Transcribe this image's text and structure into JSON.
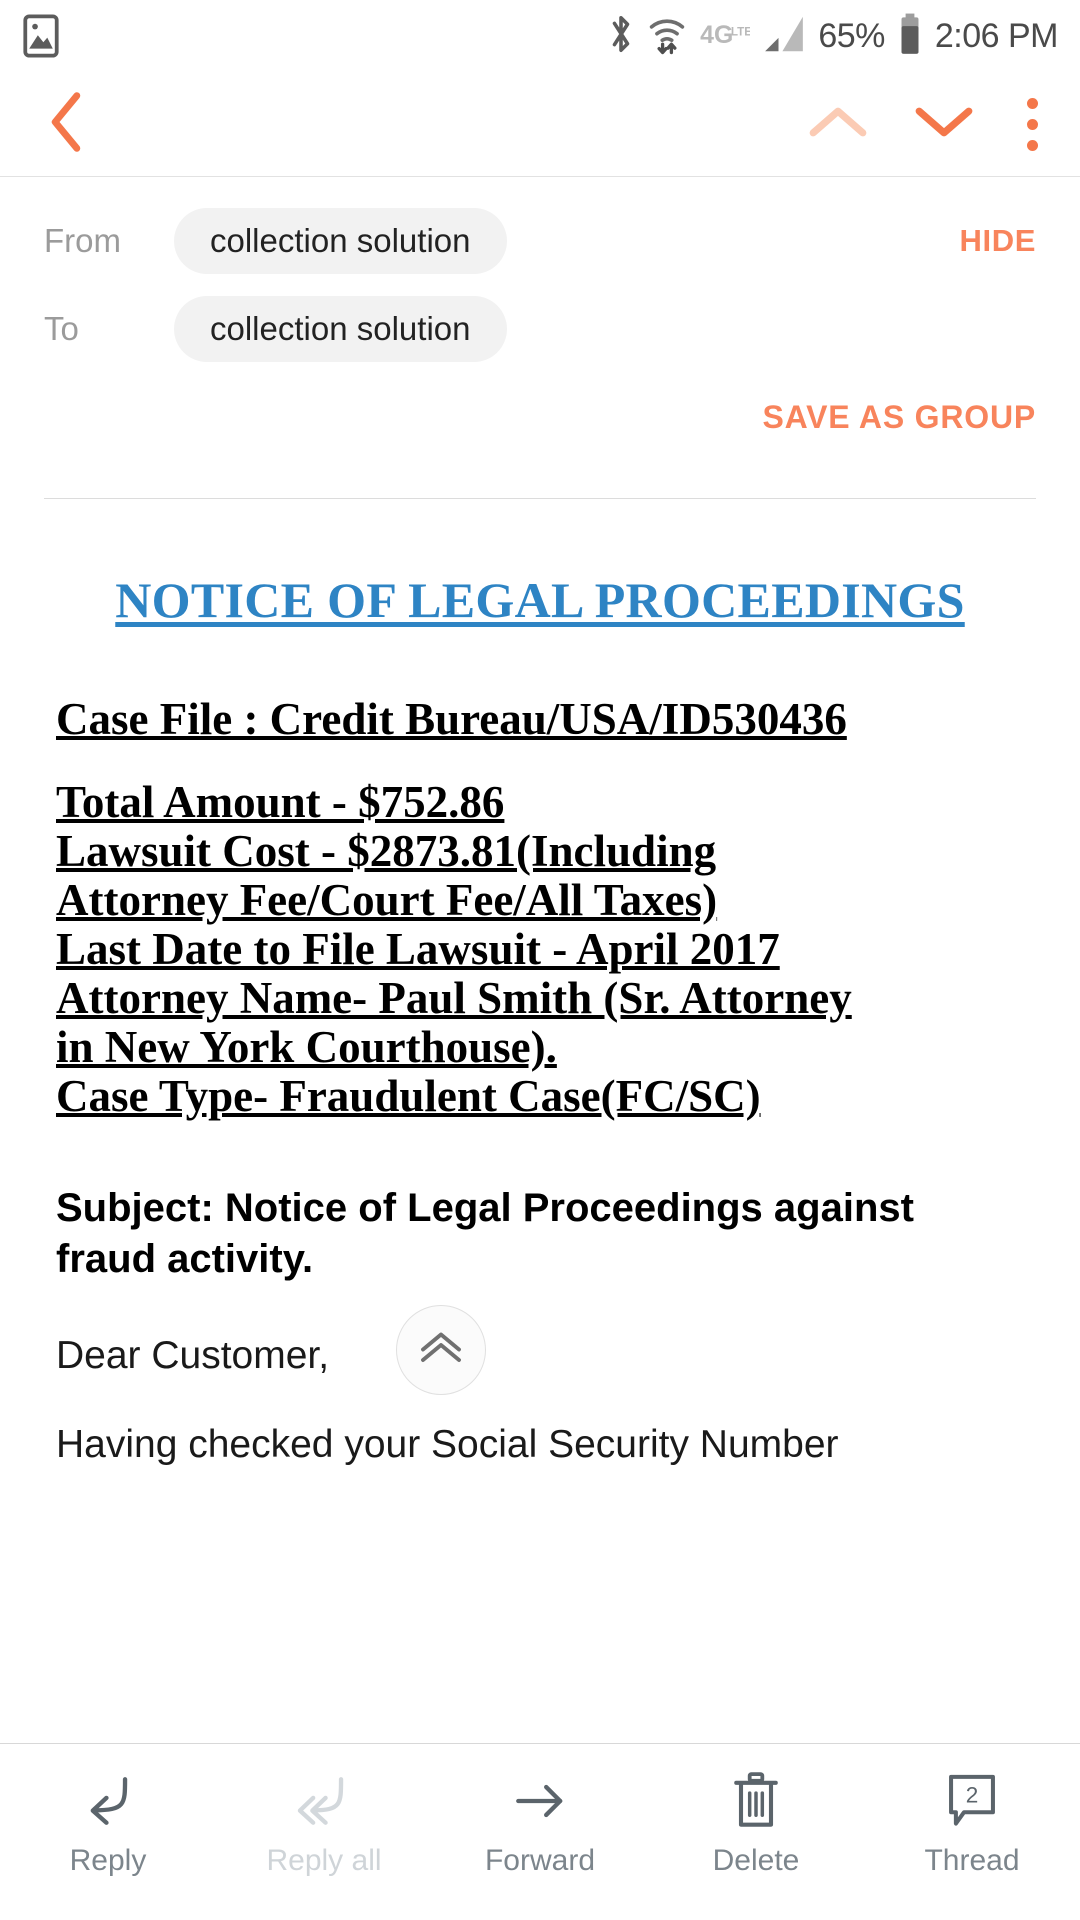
{
  "statusbar": {
    "left_icon": "image-icon",
    "icons": [
      "bluetooth-icon",
      "wifi-icon",
      "4glte-icon",
      "cellular-signal-icon"
    ],
    "battery_percent": "65%",
    "battery_icon": "battery-icon",
    "time": "2:06 PM"
  },
  "navbar": {
    "back_icon": "back-chevron-icon",
    "prev_icon": "chevron-up-icon",
    "next_icon": "chevron-down-icon",
    "overflow_icon": "more-vertical-icon",
    "accent_color": "#F4774A",
    "disabled_accent_color": "#FBCBB4"
  },
  "recipients": {
    "from_label": "From",
    "from_value": "collection solution",
    "to_label": "To",
    "to_value": "collection solution",
    "hide_label": "HIDE",
    "save_as_group_label": "SAVE AS GROUP",
    "link_color": "#F8845C"
  },
  "message": {
    "title": "NOTICE OF LEGAL PROCEEDINGS",
    "title_color": "#2E84C4",
    "details": [
      "Case File : Credit Bureau/USA/ID530436",
      "",
      "Total Amount  - $752.86",
      "Lawsuit Cost - $2873.81(Including",
      "Attorney Fee/Court Fee/All Taxes)",
      "Last Date to File Lawsuit - April 2017",
      "Attorney Name- Paul Smith (Sr. Attorney",
      "in New York Courthouse).",
      "Case Type- Fraudulent Case(FC/SC)"
    ],
    "subject": "Subject: Notice of Legal Proceedings against fraud activity.",
    "salutation": "Dear Customer,",
    "clipped_paragraph": "Having checked your Social Security Number"
  },
  "scroll_top_button": {
    "icon": "double-chevron-up-icon"
  },
  "bottombar": {
    "items": [
      {
        "label": "Reply",
        "icon": "reply-arrow-icon",
        "disabled": false,
        "badge": ""
      },
      {
        "label": "Reply all",
        "icon": "reply-all-arrow-icon",
        "disabled": true,
        "badge": ""
      },
      {
        "label": "Forward",
        "icon": "forward-arrow-icon",
        "disabled": false,
        "badge": ""
      },
      {
        "label": "Delete",
        "icon": "trash-icon",
        "disabled": false,
        "badge": ""
      },
      {
        "label": "Thread",
        "icon": "thread-bubble-icon",
        "disabled": false,
        "badge": "2"
      }
    ]
  }
}
